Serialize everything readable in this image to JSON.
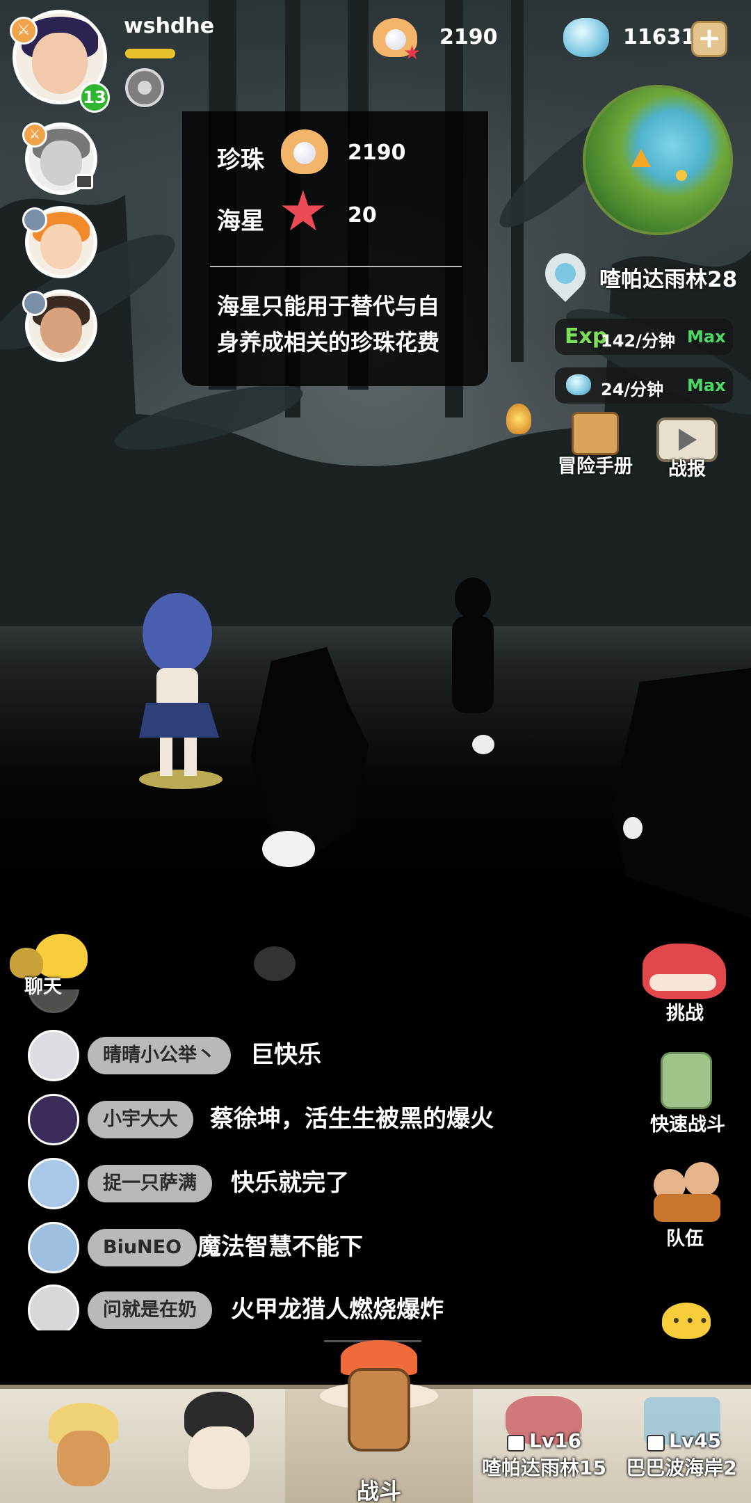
{
  "player": {
    "name": "wshdhe",
    "level": "13"
  },
  "currency": {
    "pearls": "2190",
    "diamonds": "11631",
    "add_icon": "plus-icon"
  },
  "tooltip": {
    "pearl_label": "珍珠",
    "pearl_value": "2190",
    "starfish_label": "海星",
    "starfish_value": "20",
    "desc_line1": "海星只能用于替代与自",
    "desc_line2": "身养成相关的珍珠花费"
  },
  "map": {
    "location": "喳帕达雨林28",
    "exp_label": "Exp",
    "exp_rate": "142/分钟",
    "exp_max": "Max",
    "diamond_rate": "24/分钟",
    "diamond_max": "Max"
  },
  "side_buttons": {
    "handbook": "冒险手册",
    "battle_report": "战报",
    "chat": "聊天",
    "challenge": "挑战",
    "quick_battle": "快速战斗",
    "team": "队伍"
  },
  "chat": [
    {
      "name": "晴晴小公举丶",
      "message": "巨快乐"
    },
    {
      "name": "小宇大大",
      "message": "蔡徐坤，活生生被黑的爆火"
    },
    {
      "name": "捉一只萨满",
      "message": "快乐就完了"
    },
    {
      "name": "BiuNEO",
      "message": "魔法智慧不能下"
    },
    {
      "name": "问就是在奶",
      "message": "火甲龙猎人燃烧爆炸"
    }
  ],
  "bottom_tabs": {
    "battle": "战斗",
    "zone1_level": "Lv16",
    "zone1_name": "喳帕达雨林15",
    "zone2_level": "Lv45",
    "zone2_name": "巴巴波海岸2"
  },
  "colors": {
    "max_green": "#4cd964",
    "exp_green": "#7ee05a",
    "level_badge": "#2fb52f",
    "chat_pill": "#b9b9b9"
  }
}
